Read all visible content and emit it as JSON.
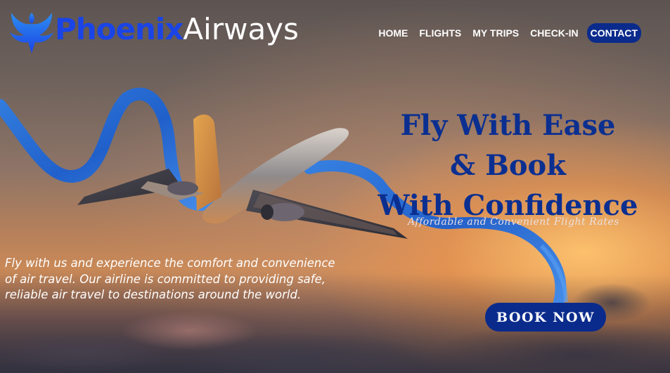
{
  "brand": {
    "name_part1": "Phoenix",
    "name_part2": "Airways",
    "logo_icon": "phoenix-bird-icon",
    "primary_color": "#1a44e6",
    "dark_blue": "#0b2b8c"
  },
  "nav": {
    "items": [
      {
        "label": "HOME"
      },
      {
        "label": "FLIGHTS"
      },
      {
        "label": "MY TRIPS"
      },
      {
        "label": "CHECK-IN"
      },
      {
        "label": "CONTACT",
        "active": true
      }
    ]
  },
  "hero": {
    "headline_line1": "Fly With Ease",
    "headline_line2": "& Book",
    "headline_line3": "With Confidence",
    "tagline": "Affordable and Convenient Flight Rates",
    "blurb": "Fly with us and experience the comfort and convenience of air travel. Our airline is committed to providing safe, reliable air travel to destinations around the world.",
    "cta_label": "BOOK NOW",
    "image": "airplane-with-blue-ribbon-sunset"
  }
}
